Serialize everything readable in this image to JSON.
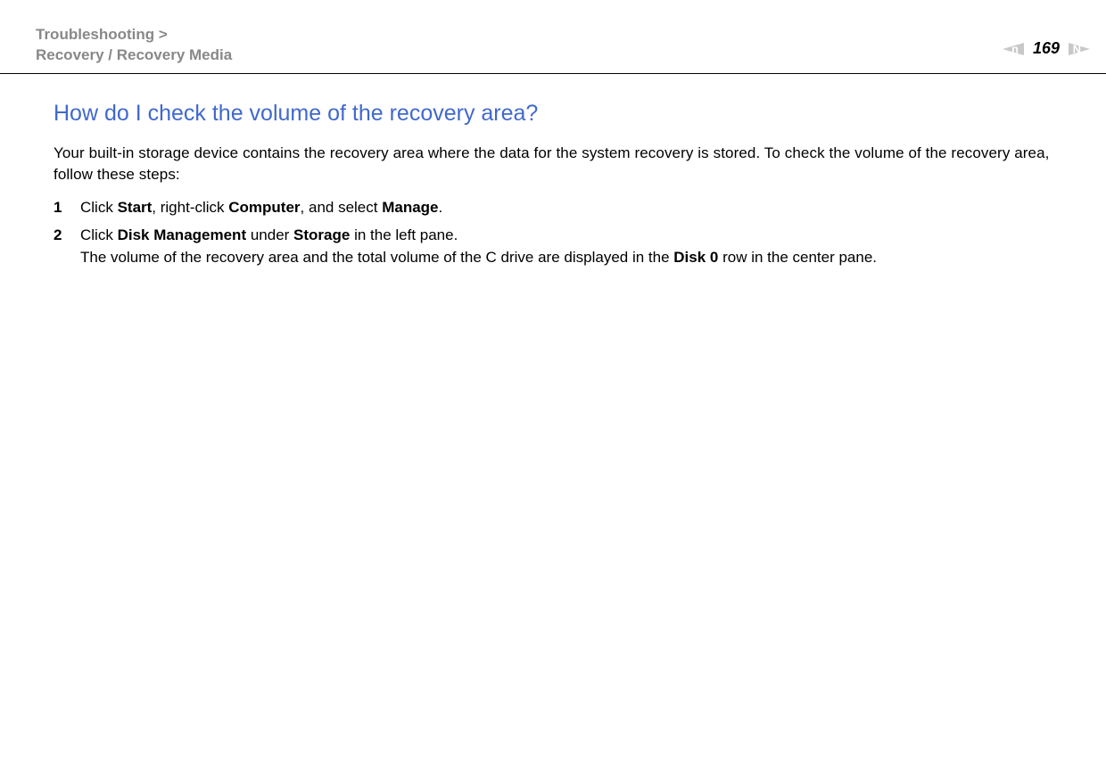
{
  "header": {
    "breadcrumb_line1": "Troubleshooting >",
    "breadcrumb_line2": "Recovery / Recovery Media",
    "page_number": "169",
    "prev_letter": "n",
    "next_letter": "N"
  },
  "content": {
    "heading": "How do I check the volume of the recovery area?",
    "intro": "Your built-in storage device contains the recovery area where the data for the system recovery is stored. To check the volume of the recovery area, follow these steps:",
    "steps": [
      {
        "num": "1",
        "p1": "Click ",
        "b1": "Start",
        "p2": ", right-click ",
        "b2": "Computer",
        "p3": ", and select ",
        "b3": "Manage",
        "p4": "."
      },
      {
        "num": "2",
        "p1": "Click ",
        "b1": "Disk Management",
        "p2": " under ",
        "b2": "Storage",
        "p3": " in the left pane.",
        "extra_p1": "The volume of the recovery area and the total volume of the C drive are displayed in the ",
        "extra_b1": "Disk 0",
        "extra_p2": " row in the center pane."
      }
    ]
  }
}
